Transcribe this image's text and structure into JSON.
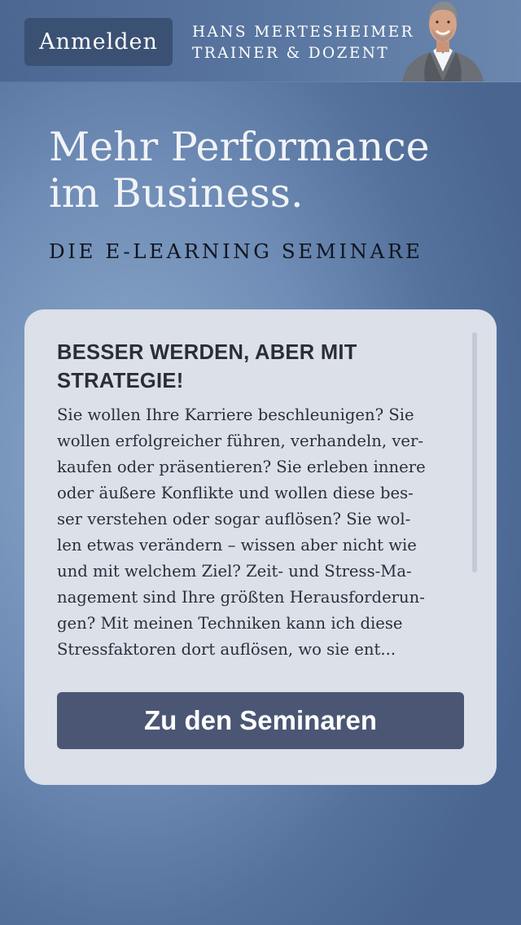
{
  "header": {
    "login_label": "Anmelden",
    "trainer_name": "HANS MERTESHEIMER",
    "trainer_role": "TRAINER & DOZENT",
    "avatar_icon": "trainer-portrait"
  },
  "hero": {
    "title": "Mehr Performance\nim Business.",
    "subtitle": "DIE E-LEARNING SEMINARE"
  },
  "card": {
    "heading": "BESSER WERDEN, ABER MIT STRATEGIE!",
    "body_lines": [
      "Sie wollen Ihre Karriere beschleunigen? Sie",
      "wollen erfolgreicher führen, verhandeln, ver-",
      "kaufen oder präsentieren? Sie erleben innere",
      "oder äußere Konflikte und wollen diese bes-",
      "ser verstehen oder sogar auflösen? Sie wol-",
      "len etwas verändern – wissen aber nicht wie",
      "und mit welchem Ziel? Zeit- und Stress-Ma-",
      "nagement sind Ihre größten Herausforderun-",
      "gen? Mit meinen Techniken kann ich diese",
      "Stressfaktoren dort auflösen, wo sie ent..."
    ],
    "cta_label": "Zu den Seminaren"
  },
  "colors": {
    "topbar": "#5a77a1",
    "login_button": "#3a5174",
    "card_background": "#dbe0e9",
    "cta_button": "#4a5674",
    "hero_subtitle": "#10151f"
  }
}
